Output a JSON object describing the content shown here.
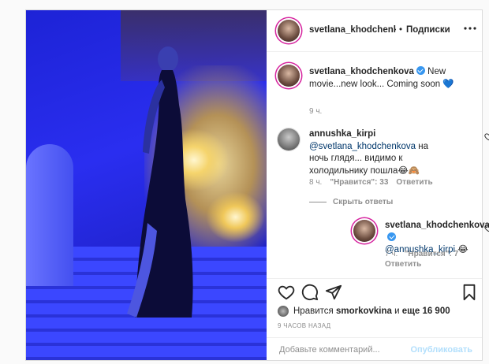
{
  "post": {
    "author": "svetlana_khodchenkov",
    "follow_label": "Подписки",
    "separator": "•"
  },
  "caption": {
    "user": "svetlana_khodchenkova",
    "text": "New movie...new look... Coming soon 💙",
    "time": "9 ч."
  },
  "comments": [
    {
      "user": "annushka_kirpi",
      "mention": "@svetlana_khodchenkova",
      "text": "на ночь глядя... видимо к холодильнику пошла😂🙈",
      "time": "8 ч.",
      "likes": "\"Нравится\": 33",
      "reply_label": "Ответить",
      "hide_replies": "Скрыть ответы",
      "replies": [
        {
          "user": "svetlana_khodchenkova",
          "mention": "@annushka_kirpi",
          "text": "😂",
          "time": "7 ч.",
          "likes": "\"Нравится\": 7",
          "reply_label": "Ответить"
        }
      ]
    }
  ],
  "likes_summary": {
    "prefix": "Нравится",
    "user": "smorkovkina",
    "middle": "и",
    "others": "еще 16 900"
  },
  "posted_ago": "9 ЧАСОВ НАЗАД",
  "add_comment": {
    "placeholder": "Добавьте комментарий...",
    "publish_label": "Опубликовать"
  },
  "colors": {
    "verified": "#3897f0",
    "publish_disabled": "#b2dffc",
    "story_ring": "#d6249f"
  },
  "icons": {
    "more": "more-horizontal-icon",
    "heart": "heart-icon",
    "comment": "comment-icon",
    "share": "share-icon",
    "save": "bookmark-icon"
  }
}
